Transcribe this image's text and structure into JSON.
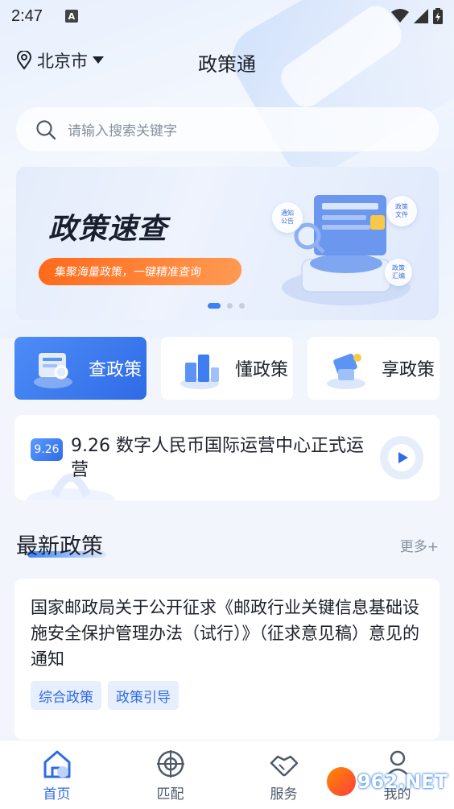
{
  "status": {
    "time": "2:47",
    "notif": "A"
  },
  "header": {
    "location": "北京市",
    "title": "政策通"
  },
  "search": {
    "placeholder": "请输入搜索关键字"
  },
  "banner": {
    "title": "政策速查",
    "subtitle": "集聚海量政策，一键精准查询",
    "bubbles": [
      "通知公告",
      "政策文件",
      "政策汇编"
    ]
  },
  "features": [
    {
      "label": "查政策",
      "icon": "search-policy-icon"
    },
    {
      "label": "懂政策",
      "icon": "understand-policy-icon"
    },
    {
      "label": "享政策",
      "icon": "enjoy-policy-icon"
    }
  ],
  "news": {
    "badge": "9.26",
    "text": "9.26 数字人民币国际运营中心正式运营"
  },
  "latest": {
    "title": "最新政策",
    "more": "更多+",
    "items": [
      {
        "title": "国家邮政局关于公开征求《邮政行业关键信息基础设施安全保护管理办法（试行）》（征求意见稿）意见的通知",
        "tags": [
          "综合政策",
          "政策引导"
        ]
      }
    ]
  },
  "tabs": [
    {
      "label": "首页",
      "icon": "home-icon"
    },
    {
      "label": "匹配",
      "icon": "match-icon"
    },
    {
      "label": "服务",
      "icon": "handshake-icon"
    },
    {
      "label": "我的",
      "icon": "user-icon"
    }
  ],
  "watermark": {
    "text": "962.NET"
  },
  "colors": {
    "primary": "#2f6be6",
    "accent": "#ff6a1a"
  }
}
